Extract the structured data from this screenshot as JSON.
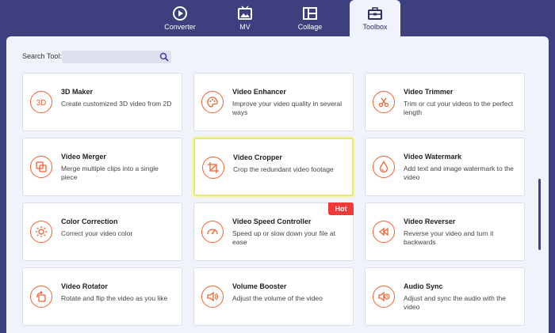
{
  "nav": {
    "tabs": [
      {
        "label": "Converter",
        "icon": "converter-icon"
      },
      {
        "label": "MV",
        "icon": "mv-icon"
      },
      {
        "label": "Collage",
        "icon": "collage-icon"
      },
      {
        "label": "Toolbox",
        "icon": "toolbox-icon",
        "active": true
      }
    ]
  },
  "search": {
    "label": "Search Tool:",
    "value": "",
    "placeholder": ""
  },
  "tools": [
    {
      "title": "3D Maker",
      "desc": "Create customized 3D video from 2D",
      "icon": "3d-icon"
    },
    {
      "title": "Video Enhancer",
      "desc": "Improve your video quality in several ways",
      "icon": "palette-icon"
    },
    {
      "title": "Video Trimmer",
      "desc": "Trim or cut your videos to the perfect length",
      "icon": "scissors-icon"
    },
    {
      "title": "Video Merger",
      "desc": "Merge multiple clips into a single piece",
      "icon": "merge-icon"
    },
    {
      "title": "Video Cropper",
      "desc": "Crop the redundant video footage",
      "icon": "crop-icon",
      "selected": true
    },
    {
      "title": "Video Watermark",
      "desc": "Add text and image watermark to the video",
      "icon": "droplet-icon"
    },
    {
      "title": "Color Correction",
      "desc": "Correct your video color",
      "icon": "sun-icon"
    },
    {
      "title": "Video Speed Controller",
      "desc": "Speed up or slow down your file at ease",
      "icon": "speedometer-icon",
      "badge": "Hot"
    },
    {
      "title": "Video Reverser",
      "desc": "Reverse your video and turn it backwards",
      "icon": "rewind-icon"
    },
    {
      "title": "Video Rotator",
      "desc": "Rotate and flip the video as you like",
      "icon": "rotate-icon"
    },
    {
      "title": "Volume Booster",
      "desc": "Adjust the volume of the video",
      "icon": "volume-icon"
    },
    {
      "title": "Audio Sync",
      "desc": "Adjust and sync the audio with the video",
      "icon": "audio-sync-icon"
    }
  ],
  "colors": {
    "accent": "#f0622f",
    "background": "#3d3f7f",
    "panel": "#f1f3fb",
    "hot": "#ee3a3a",
    "selected_border": "#e2ea74"
  }
}
